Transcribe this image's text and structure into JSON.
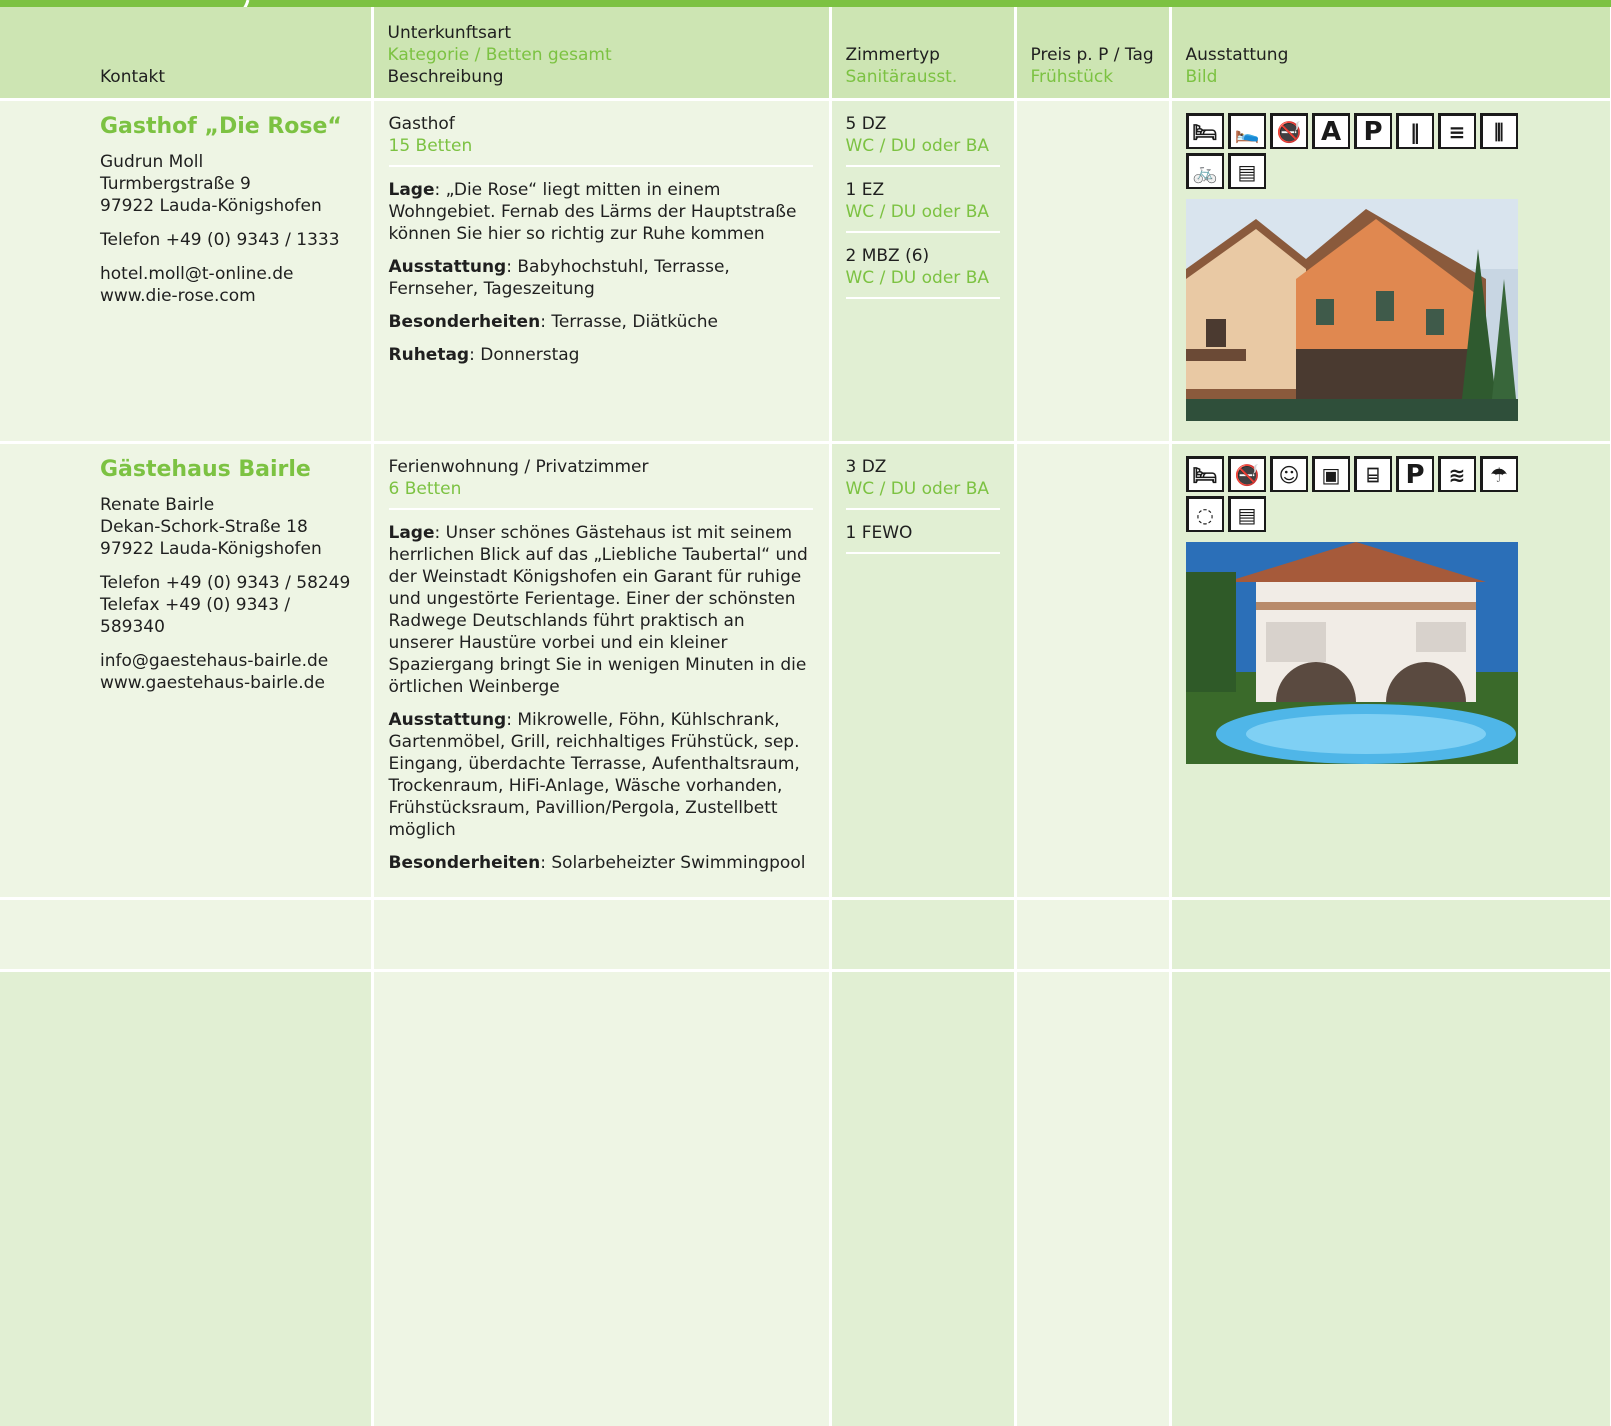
{
  "header": {
    "kontakt": "Kontakt",
    "unterkunftsart": "Unterkunftsart",
    "kategorie": "Kategorie / Betten gesamt",
    "beschreibung": "Beschreibung",
    "zimmertyp": "Zimmertyp",
    "sanitaer": "Sanitärausst.",
    "preis": "Preis p. P / Tag",
    "fruehstueck": "Frühstück",
    "ausstattung": "Ausstattung",
    "bild": "Bild"
  },
  "listings": [
    {
      "name": "Gasthof „Die Rose“",
      "person": "Gudrun Moll",
      "street": "Turmbergstraße 9",
      "city": "97922 Lauda-Königshofen",
      "phone": "Telefon +49 (0) 9343 / 1333",
      "email": "hotel.moll@t-online.de",
      "web": "www.die-rose.com",
      "type": "Gasthof",
      "beds": "15 Betten",
      "lage_label": "Lage",
      "lage": ": „Die Rose“ liegt mitten in einem Wohngebiet. Fernab des Lärms der Hauptstraße können Sie hier so richtig zur Ruhe kommen",
      "ausstattung_label": "Ausstattung",
      "ausstattung": ": Babyhochstuhl, Terrasse, Fernseher, Tageszeitung",
      "besonderheiten_label": "Besonderheiten",
      "besonderheiten": ": Terrasse, Diätküche",
      "ruhetag_label": "Ruhetag",
      "ruhetag": ": Donnerstag",
      "rooms": [
        {
          "type": "5 DZ",
          "sanitary": "WC / DU oder BA"
        },
        {
          "type": "1 EZ",
          "sanitary": "WC / DU oder BA"
        },
        {
          "type": "2 MBZ (6)",
          "sanitary": "WC / DU oder BA"
        }
      ],
      "icons": [
        "tv-bed-icon",
        "baby-bed-icon",
        "no-smoking-bed-icon",
        "A",
        "P",
        "cutlery-icon",
        "kitchen-icon",
        "restaurant-icon",
        "bicycle-icon",
        "info-board-icon"
      ]
    },
    {
      "name": "Gästehaus Bairle",
      "person": "Renate Bairle",
      "street": "Dekan-Schork-Straße 18",
      "city": "97922 Lauda-Königshofen",
      "phone": "Telefon +49 (0) 9343 / 58249",
      "fax": "Telefax +49 (0) 9343 / 589340",
      "email": "info@gaestehaus-bairle.de",
      "web": "www.gaestehaus-bairle.de",
      "type": "Ferienwohnung / Privatzimmer",
      "beds": "6 Betten",
      "lage_label": "Lage",
      "lage": ": Unser schönes Gästehaus ist mit seinem herrlichen Blick auf das „Liebliche Taubertal“ und der Weinstadt Königshofen ein Garant für ruhige und ungestörte Ferientage. Einer der schönsten Radwege Deutschlands führt praktisch an unserer Haustüre vorbei und ein kleiner Spaziergang bringt Sie in wenigen Minuten in die örtlichen Weinberge",
      "ausstattung_label": "Ausstattung",
      "ausstattung": ": Mikrowelle, Föhn, Kühlschrank, Gartenmöbel, Grill, reichhaltiges Frühstück, sep. Eingang, überdachte Terrasse, Aufenthaltsraum, Trockenraum, HiFi-Anlage, Wäsche vorhanden, Frühstücksraum, Pavillion/Pergola, Zustellbett möglich",
      "besonderheiten_label": "Besonderheiten",
      "besonderheiten": ": Solarbeheizter Swimmingpool",
      "rooms": [
        {
          "type": "3 DZ",
          "sanitary": "WC / DU oder BA"
        },
        {
          "type": "1 FEWO",
          "sanitary": ""
        }
      ],
      "icons": [
        "tv-bed-icon",
        "no-smoking-bed-icon",
        "child-icon",
        "tv-icon",
        "luggage-icon",
        "P",
        "pool-icon",
        "sunbed-icon",
        "wheelchair-icon",
        "info-board-icon"
      ]
    }
  ]
}
